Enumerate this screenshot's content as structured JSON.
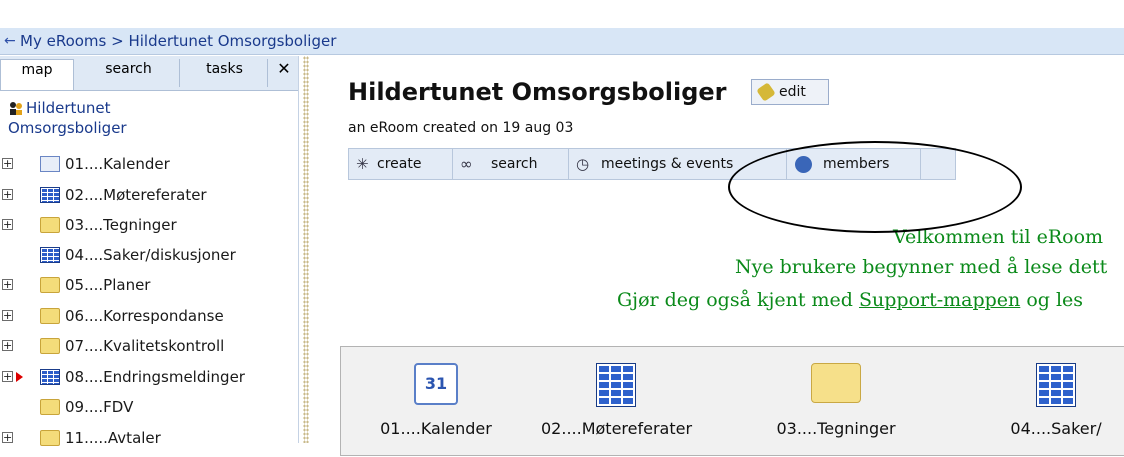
{
  "breadcrumb": {
    "text": "My eRooms > Hildertunet Omsorgsboliger"
  },
  "sidebar": {
    "tabs": {
      "map": "map",
      "search": "search",
      "tasks": "tasks",
      "close": "✕"
    },
    "room": {
      "line1": "Hildertunet",
      "line2": "Omsorgsboliger"
    },
    "items": [
      {
        "label": "01....Kalender",
        "icon": "calendar-icon"
      },
      {
        "label": "02....Møtereferater",
        "icon": "database-icon"
      },
      {
        "label": "03....Tegninger",
        "icon": "folder-icon"
      },
      {
        "label": "04....Saker/diskusjoner",
        "icon": "database-icon"
      },
      {
        "label": "05....Planer",
        "icon": "folder-icon"
      },
      {
        "label": "06....Korrespondanse",
        "icon": "folder-icon"
      },
      {
        "label": "07....Kvalitetskontroll",
        "icon": "folder-icon"
      },
      {
        "label": "08....Endringsmeldinger",
        "icon": "database-icon"
      },
      {
        "label": "09....FDV",
        "icon": "folder-icon"
      },
      {
        "label": "11.....Avtaler",
        "icon": "folder-icon"
      }
    ]
  },
  "main": {
    "title": "Hildertunet Omsorgsboliger",
    "edit_label": "edit",
    "subtitle": "an eRoom created on 19 aug 03",
    "toolbar": {
      "create": "create",
      "search": "search",
      "meetings": "meetings & events",
      "members": "members"
    },
    "welcome": {
      "line1": "Velkommen til eRoom",
      "line2": "Nye brukere begynner med å lese dett",
      "line3_pre": "Gjør deg også kjent med ",
      "line3_link": "Support-mappen",
      "line3_post": " og les"
    },
    "panel": [
      {
        "label": "01....Kalender",
        "icon": "calendar-icon",
        "cal_day": "31"
      },
      {
        "label": "02....Møtereferater",
        "icon": "database-icon"
      },
      {
        "label": "03....Tegninger",
        "icon": "folder-icon"
      },
      {
        "label": "04....Saker/",
        "icon": "database-icon"
      }
    ]
  },
  "colors": {
    "accent": "#1a3a8c",
    "welcome_text": "#0b8a1a",
    "breadcrumb_bg": "#d8e6f6"
  }
}
